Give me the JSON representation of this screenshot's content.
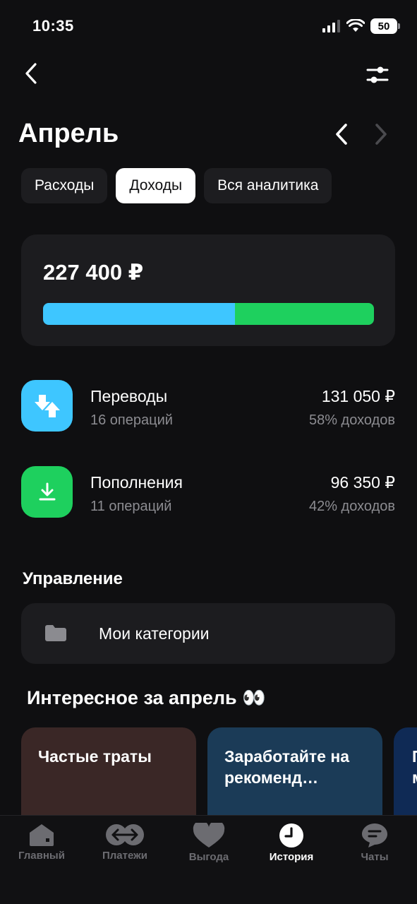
{
  "status_bar": {
    "time": "10:35",
    "battery": "50"
  },
  "header": {
    "back_icon": "chevron-left-icon",
    "filter_icon": "sliders-icon"
  },
  "month": {
    "title": "Апрель",
    "prev_icon": "chevron-left-icon",
    "next_icon": "chevron-right-icon"
  },
  "tabs": [
    {
      "label": "Расходы",
      "active": false
    },
    {
      "label": "Доходы",
      "active": true
    },
    {
      "label": "Вся аналитика",
      "active": false
    }
  ],
  "summary": {
    "total": "227 400 ₽",
    "segments": [
      {
        "share": 0.58,
        "color": "#3ec6ff"
      },
      {
        "share": 0.42,
        "color": "#1ed05e"
      }
    ]
  },
  "operations": [
    {
      "name": "Переводы",
      "count": "16 операций",
      "amount": "131 050 ₽",
      "share": "58% доходов",
      "icon": "transfer-arrows-icon",
      "color": "#3ec6ff"
    },
    {
      "name": "Пополнения",
      "count": "11 операций",
      "amount": "96 350 ₽",
      "share": "42% доходов",
      "icon": "download-icon",
      "color": "#1ed05e"
    }
  ],
  "management": {
    "title": "Управление",
    "item_label": "Мои категории",
    "item_icon": "folder-icon"
  },
  "interesting": {
    "title": "Интересное за апрель 👀",
    "stories": [
      {
        "text": "Частые траты",
        "color": "#3a2726"
      },
      {
        "text": "Заработайте на рекоменд…",
        "color": "#1b3b57"
      },
      {
        "text": "П м",
        "color": "#0f2a55"
      }
    ]
  },
  "tab_bar": [
    {
      "label": "Главный",
      "icon": "home-icon",
      "active": false
    },
    {
      "label": "Платежи",
      "icon": "payments-arrows-icon",
      "active": false
    },
    {
      "label": "Выгода",
      "icon": "heart-icon",
      "active": false
    },
    {
      "label": "История",
      "icon": "clock-icon",
      "active": true
    },
    {
      "label": "Чаты",
      "icon": "chat-icon",
      "active": false
    }
  ]
}
